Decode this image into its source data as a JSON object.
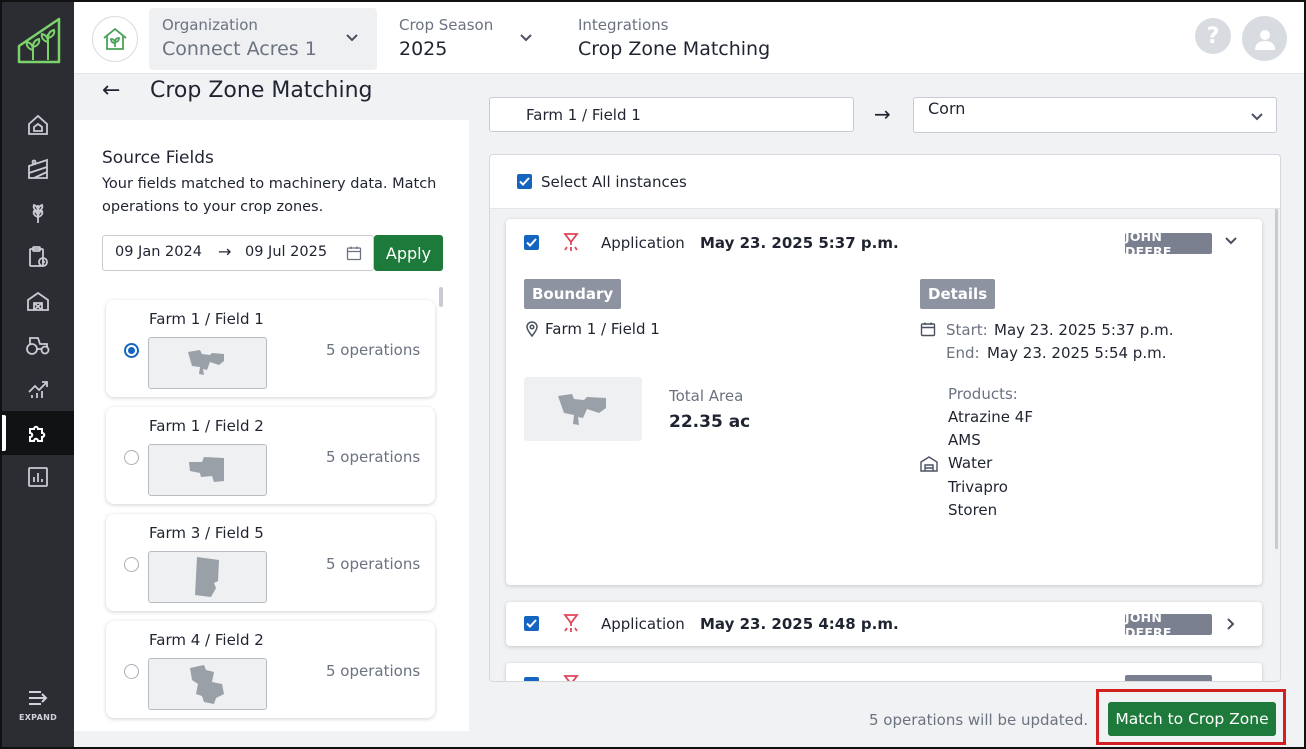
{
  "header": {
    "organization_label": "Organization",
    "organization_value": "Connect Acres 1",
    "season_label": "Crop Season",
    "season_value": "2025",
    "integrations_label": "Integrations",
    "integrations_value": "Crop Zone Matching",
    "help_symbol": "?"
  },
  "sidebar": {
    "items": [
      "home-icon",
      "field-icon",
      "crop-icon",
      "clipboard-icon",
      "barn-icon",
      "tractor-icon",
      "analytics-icon",
      "puzzle-icon",
      "report-icon"
    ],
    "active_item": "puzzle-icon",
    "expand_label": "EXPAND"
  },
  "page": {
    "title": "Crop Zone Matching"
  },
  "source": {
    "title": "Source Fields",
    "description": "Your fields matched to machinery data. Match operations to your crop zones.",
    "date_from": "09 Jan 2024",
    "date_to": "09 Jul 2025",
    "apply_label": "Apply",
    "fields": [
      {
        "name": "Farm 1 / Field 1",
        "operations": "5 operations",
        "selected": true
      },
      {
        "name": "Farm 1 / Field 2",
        "operations": "5 operations",
        "selected": false
      },
      {
        "name": "Farm 3 / Field 5",
        "operations": "5 operations",
        "selected": false
      },
      {
        "name": "Farm 4 / Field 2",
        "operations": "5 operations",
        "selected": false
      }
    ]
  },
  "mapping": {
    "source_field": "Farm 1 / Field 1",
    "crop_zone": "Corn"
  },
  "operations": {
    "select_all_label": "Select All instances",
    "items": [
      {
        "type": "Application",
        "datetime": "May 23. 2025 5:37 p.m.",
        "provider": "JOHN DEERE",
        "expanded": true,
        "boundary_tag": "Boundary",
        "details_tag": "Details",
        "boundary_field": "Farm 1 / Field 1",
        "total_area_label": "Total Area",
        "total_area_value": "22.35 ac",
        "start_label": "Start:",
        "start_value": "May 23. 2025 5:37 p.m.",
        "end_label": "End:",
        "end_value": "May 23. 2025 5:54 p.m.",
        "products_label": "Products:",
        "products": [
          "Atrazine 4F",
          "AMS",
          "Water",
          "Trivapro",
          "Storen"
        ]
      },
      {
        "type": "Application",
        "datetime": "May 23. 2025 4:48 p.m.",
        "provider": "JOHN DEERE",
        "expanded": false
      }
    ]
  },
  "footer": {
    "note": "5 operations will be updated.",
    "match_label": "Match to Crop Zone"
  },
  "colors": {
    "sidebar_bg": "#2b2d33",
    "accent_green": "#1e7a3a",
    "checkbox_blue": "#1565c0",
    "highlight_red": "#d21f1f",
    "logo_green": "#7bd36a"
  }
}
